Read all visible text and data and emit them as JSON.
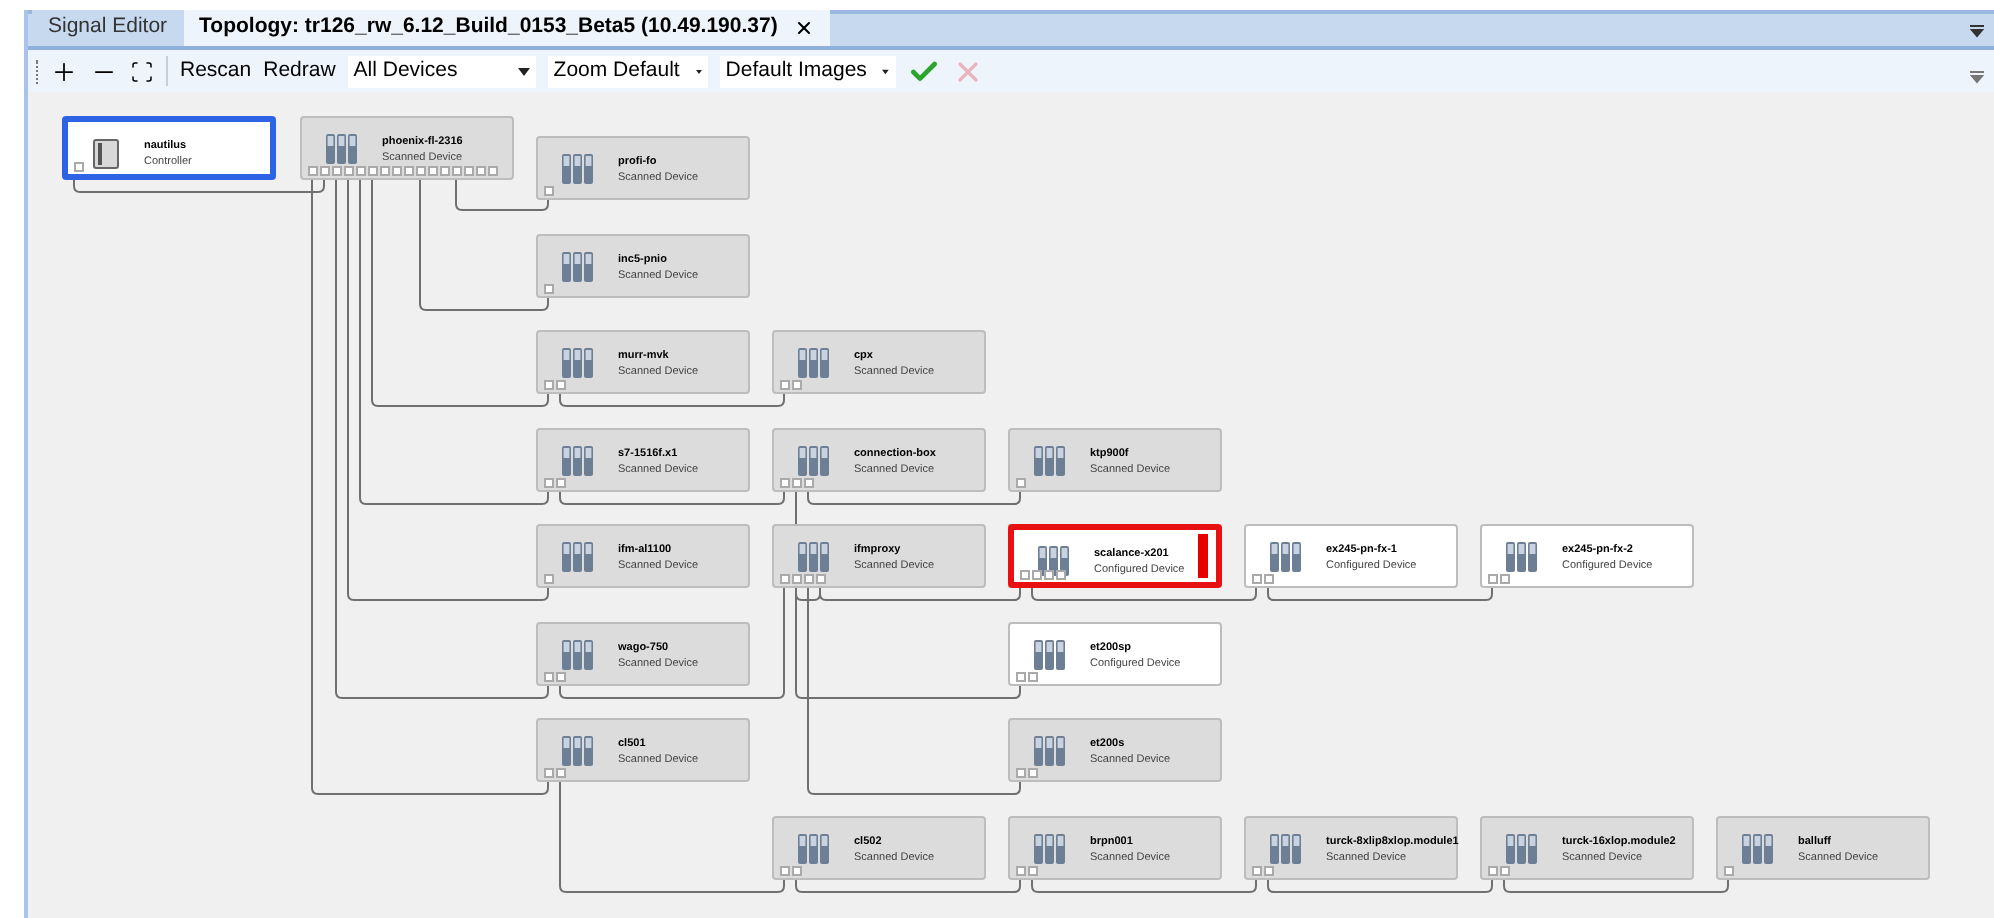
{
  "tabs": [
    {
      "label": "Signal Editor",
      "selected": false,
      "closable": false
    },
    {
      "label": "Topology: tr126_rw_6.12_Build_0153_Beta5 (10.49.190.37)",
      "selected": true,
      "closable": true
    }
  ],
  "toolbar": {
    "buttons": [
      {
        "label": "Rescan"
      },
      {
        "label": "Redraw"
      }
    ],
    "dropdowns": [
      {
        "value": "All Devices"
      },
      {
        "value": "Zoom Default"
      },
      {
        "value": "Default Images"
      }
    ],
    "actions": [
      {
        "kind": "apply",
        "disabled": false
      },
      {
        "kind": "cancel",
        "disabled": true
      }
    ]
  },
  "nodes": [
    {
      "name": "nautilus",
      "subtitle": "Controller",
      "kind": "controller",
      "selected": true,
      "highlighted": false
    },
    {
      "name": "phoenix-fl-2316",
      "subtitle": "Scanned Device",
      "kind": "scanned",
      "selected": false,
      "highlighted": false
    },
    {
      "name": "profi-fo",
      "subtitle": "Scanned Device",
      "kind": "scanned",
      "selected": false,
      "highlighted": false
    },
    {
      "name": "inc5-pnio",
      "subtitle": "Scanned Device",
      "kind": "scanned",
      "selected": false,
      "highlighted": false
    },
    {
      "name": "murr-mvk",
      "subtitle": "Scanned Device",
      "kind": "scanned",
      "selected": false,
      "highlighted": false
    },
    {
      "name": "cpx",
      "subtitle": "Scanned Device",
      "kind": "scanned",
      "selected": false,
      "highlighted": false
    },
    {
      "name": "s7-1516f.x1",
      "subtitle": "Scanned Device",
      "kind": "scanned",
      "selected": false,
      "highlighted": false
    },
    {
      "name": "connection-box",
      "subtitle": "Scanned Device",
      "kind": "scanned",
      "selected": false,
      "highlighted": false
    },
    {
      "name": "ktp900f",
      "subtitle": "Scanned Device",
      "kind": "scanned",
      "selected": false,
      "highlighted": false
    },
    {
      "name": "ifm-al1100",
      "subtitle": "Scanned Device",
      "kind": "scanned",
      "selected": false,
      "highlighted": false
    },
    {
      "name": "ifmproxy",
      "subtitle": "Scanned Device",
      "kind": "scanned",
      "selected": false,
      "highlighted": false
    },
    {
      "name": "scalance-x201",
      "subtitle": "Configured Device",
      "kind": "configured",
      "selected": false,
      "highlighted": true
    },
    {
      "name": "ex245-pn-fx-1",
      "subtitle": "Configured Device",
      "kind": "configured",
      "selected": false,
      "highlighted": false
    },
    {
      "name": "ex245-pn-fx-2",
      "subtitle": "Configured Device",
      "kind": "configured",
      "selected": false,
      "highlighted": false
    },
    {
      "name": "wago-750",
      "subtitle": "Scanned Device",
      "kind": "scanned",
      "selected": false,
      "highlighted": false
    },
    {
      "name": "et200sp",
      "subtitle": "Configured Device",
      "kind": "configured",
      "selected": false,
      "highlighted": false
    },
    {
      "name": "cl501",
      "subtitle": "Scanned Device",
      "kind": "scanned",
      "selected": false,
      "highlighted": false
    },
    {
      "name": "et200s",
      "subtitle": "Scanned Device",
      "kind": "scanned",
      "selected": false,
      "highlighted": false
    },
    {
      "name": "cl502",
      "subtitle": "Scanned Device",
      "kind": "scanned",
      "selected": false,
      "highlighted": false
    },
    {
      "name": "brpn001",
      "subtitle": "Scanned Device",
      "kind": "scanned",
      "selected": false,
      "highlighted": false
    },
    {
      "name": "turck-8xlip8xlop.module1",
      "subtitle": "Scanned Device",
      "kind": "scanned",
      "selected": false,
      "highlighted": false
    },
    {
      "name": "turck-16xlop.module2",
      "subtitle": "Scanned Device",
      "kind": "scanned",
      "selected": false,
      "highlighted": false
    },
    {
      "name": "balluff",
      "subtitle": "Scanned Device",
      "kind": "scanned",
      "selected": false,
      "highlighted": false
    }
  ]
}
